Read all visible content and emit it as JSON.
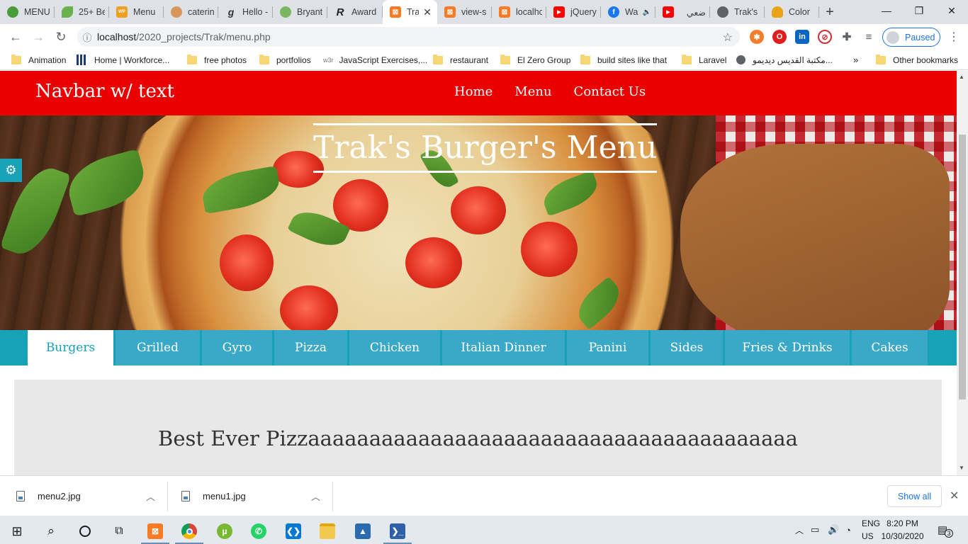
{
  "browser": {
    "tabs": [
      {
        "title": "MENU",
        "icon": "green-red-circle-icon",
        "color": "#4a9b3a"
      },
      {
        "title": "25+ Be",
        "icon": "leaf-icon",
        "color": "#6ab04c"
      },
      {
        "title": "Menu",
        "icon": "wpfr-icon",
        "color": "#f0a020"
      },
      {
        "title": "caterin",
        "icon": "chef-icon",
        "color": "#d9965b"
      },
      {
        "title": "Hello -",
        "icon": "g-icon",
        "color": "#333333"
      },
      {
        "title": "Bryant",
        "icon": "green-circle-icon",
        "color": "#7bb661"
      },
      {
        "title": "Award",
        "icon": "r-icon",
        "color": "#222222"
      },
      {
        "title": "Tra",
        "icon": "xampp-icon",
        "color": "#fb7a24",
        "active": true
      },
      {
        "title": "view-s",
        "icon": "xampp-icon",
        "color": "#fb7a24"
      },
      {
        "title": "localhc",
        "icon": "xampp-icon",
        "color": "#fb7a24"
      },
      {
        "title": "jQuery",
        "icon": "youtube-icon",
        "color": "#ff0000"
      },
      {
        "title": "Wa",
        "icon": "facebook-icon",
        "color": "#1877f2"
      },
      {
        "title": "ضعي",
        "icon": "youtube-icon",
        "color": "#ff0000"
      },
      {
        "title": "Trak's",
        "icon": "globe-icon",
        "color": "#5f6368"
      },
      {
        "title": "Color",
        "icon": "color-icon",
        "color": "#e8a317"
      }
    ],
    "url": {
      "host": "localhost",
      "path": "/2020_projects/Trak/menu.php"
    },
    "profile_label": "Paused",
    "bookmarks": [
      {
        "label": "Animation",
        "type": "folder"
      },
      {
        "label": "Home | Workforce...",
        "type": "grid"
      },
      {
        "label": "free photos",
        "type": "folder"
      },
      {
        "label": "portfolios",
        "type": "folder"
      },
      {
        "label": "JavaScript Exercises,...",
        "type": "w3r"
      },
      {
        "label": "restaurant",
        "type": "folder"
      },
      {
        "label": "El Zero Group",
        "type": "folder"
      },
      {
        "label": "build sites like that",
        "type": "folder"
      },
      {
        "label": "Laravel",
        "type": "folder"
      },
      {
        "label": "مكتبة القديس ديديمو...",
        "type": "globe"
      }
    ],
    "bookmarks_overflow": "»",
    "other_bookmarks": "Other bookmarks"
  },
  "site": {
    "brand": "Navbar w/ text",
    "nav": [
      "Home",
      "Menu",
      "Contact Us"
    ],
    "hero_title": "Trak's Burger's Menu",
    "menu_tabs": [
      "Burgers",
      "Grilled",
      "Gyro",
      "Pizza",
      "Chicken",
      "Italian Dinner",
      "Panini",
      "Sides",
      "Fries & Drinks",
      "Cakes"
    ],
    "active_tab": "Burgers",
    "card_heading": "Best Ever Pizzaaaaaaaaaaaaaaaaaaaaaaaaaaaaaaaaaaaaaaaa"
  },
  "downloads": {
    "items": [
      "menu2.jpg",
      "menu1.jpg"
    ],
    "show_all": "Show all"
  },
  "taskbar": {
    "lang_top": "ENG",
    "lang_bottom": "US",
    "time": "8:20 PM",
    "date": "10/30/2020",
    "notifications": "3"
  },
  "colors": {
    "navbar": "#ea0000",
    "menu_tabs": "#17a2b8",
    "tab_fill": "#3aa9c8",
    "card": "#e8e8e8"
  }
}
